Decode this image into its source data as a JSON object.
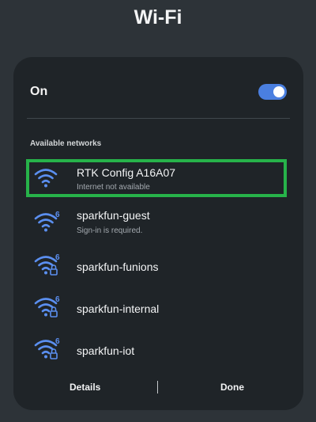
{
  "header": {
    "title": "Wi-Fi"
  },
  "wifi": {
    "state_label": "On",
    "enabled": true
  },
  "section": {
    "available_label": "Available networks"
  },
  "networks": [
    {
      "name": "RTK Config A16A07",
      "status": "Internet not available",
      "icon": "wifi-signal-icon",
      "wifi6": false,
      "secured": false,
      "highlighted": true
    },
    {
      "name": "sparkfun-guest",
      "status": "Sign-in is required.",
      "icon": "wifi6-signal-icon",
      "wifi6": true,
      "secured": false,
      "highlighted": false
    },
    {
      "name": "sparkfun-funions",
      "status": "",
      "icon": "wifi6-lock-icon",
      "wifi6": true,
      "secured": true,
      "highlighted": false
    },
    {
      "name": "sparkfun-internal",
      "status": "",
      "icon": "wifi6-lock-icon",
      "wifi6": true,
      "secured": true,
      "highlighted": false
    },
    {
      "name": "sparkfun-iot",
      "status": "",
      "icon": "wifi6-lock-icon",
      "wifi6": true,
      "secured": true,
      "highlighted": false
    }
  ],
  "footer": {
    "details_label": "Details",
    "done_label": "Done"
  },
  "colors": {
    "accent": "#4a7fe0",
    "highlight": "#27b34a",
    "panel": "#1f2428",
    "background": "#2d3338"
  }
}
